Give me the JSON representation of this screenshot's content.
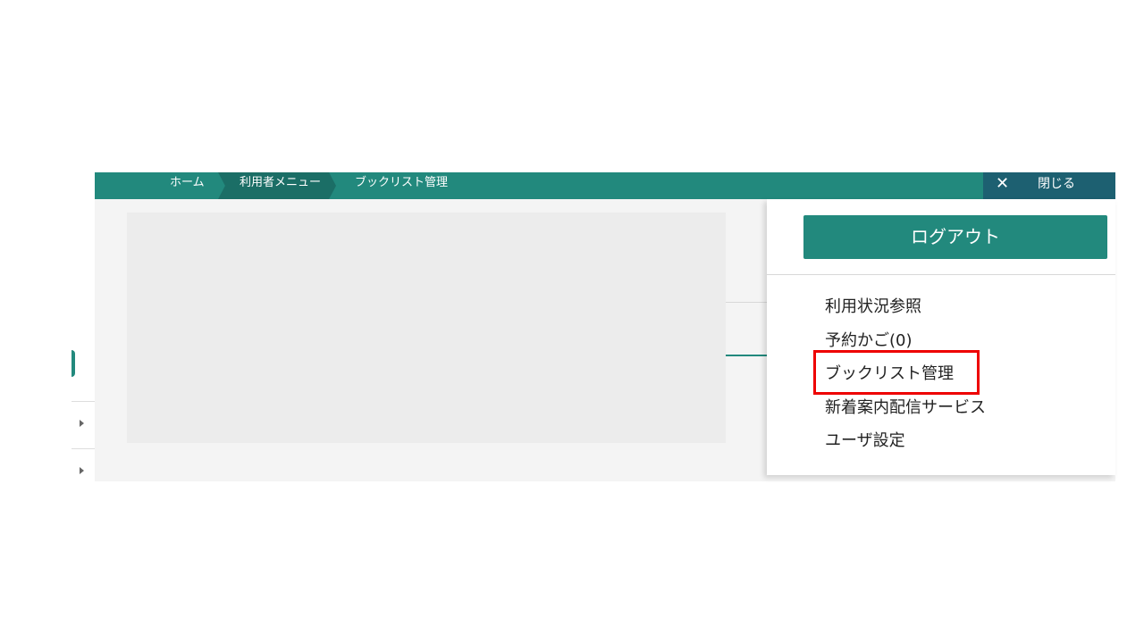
{
  "breadcrumb": {
    "items": [
      "ホーム",
      "利用者メニュー",
      "ブックリスト管理"
    ]
  },
  "close_button": {
    "icon": "close-icon",
    "label": "閉じる"
  },
  "dropdown": {
    "logout_label": "ログアウト",
    "menu_items": [
      "利用状況参照",
      "予約かご(0)",
      "ブックリスト管理",
      "新着案内配信サービス",
      "ユーザ設定"
    ],
    "highlighted_item": "ブックリスト管理"
  },
  "colors": {
    "accent": "#22897d",
    "breadcrumb_active": "#1b6e66",
    "close_bg": "#1d6071",
    "highlight": "#ee0000"
  }
}
